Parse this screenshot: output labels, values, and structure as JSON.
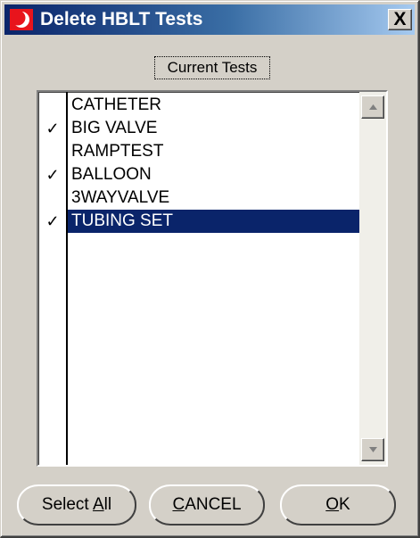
{
  "window": {
    "title": "Delete HBLT Tests",
    "close_label": "X"
  },
  "group": {
    "label": "Current Tests"
  },
  "list": {
    "items": [
      {
        "label": "CATHETER",
        "checked": false,
        "selected": false
      },
      {
        "label": "BIG VALVE",
        "checked": true,
        "selected": false
      },
      {
        "label": "RAMPTEST",
        "checked": false,
        "selected": false
      },
      {
        "label": "BALLOON",
        "checked": true,
        "selected": false
      },
      {
        "label": "3WAYVALVE",
        "checked": false,
        "selected": false
      },
      {
        "label": "TUBING SET",
        "checked": true,
        "selected": true
      }
    ],
    "check_mark": "✓",
    "selection_color": "#0a246a"
  },
  "buttons": {
    "select_all": {
      "prefix": "Select ",
      "mnemonic": "A",
      "suffix": "ll"
    },
    "cancel": {
      "prefix": "",
      "mnemonic": "C",
      "suffix": "ANCEL"
    },
    "ok": {
      "prefix": "",
      "mnemonic": "O",
      "suffix": "K"
    }
  },
  "icons": {
    "app": "red-crescent-icon",
    "close": "close-icon",
    "scroll_up": "scroll-up-arrow-icon",
    "scroll_down": "scroll-down-arrow-icon"
  }
}
